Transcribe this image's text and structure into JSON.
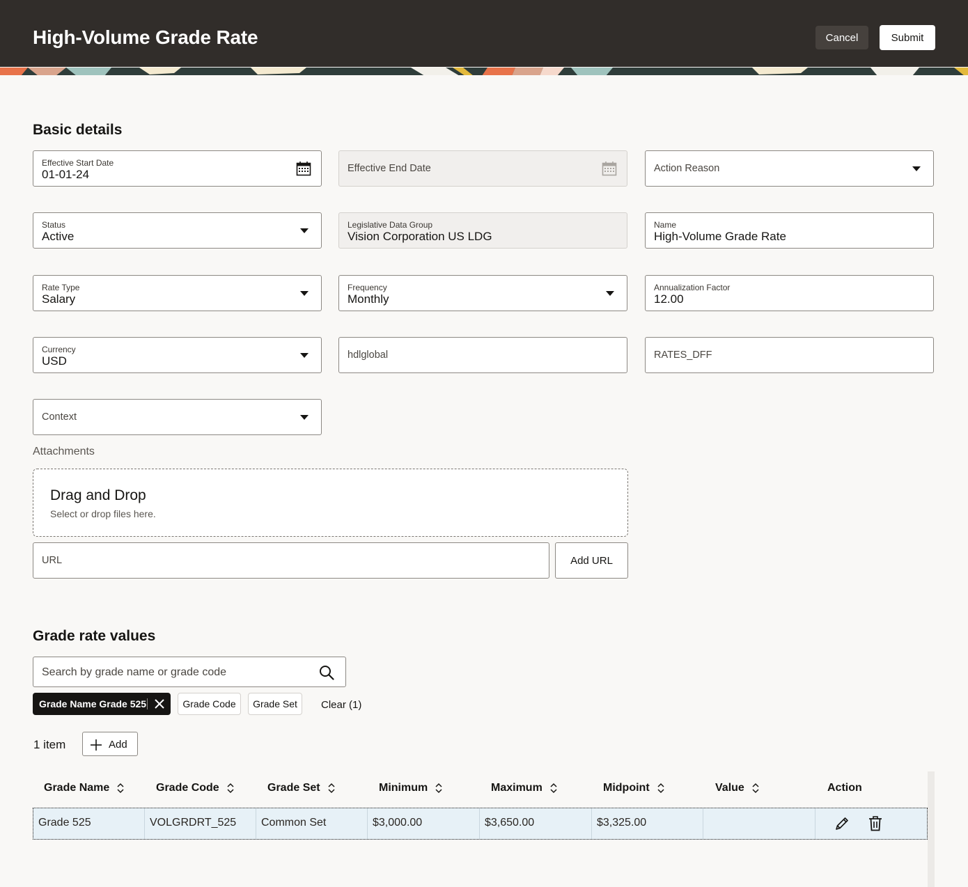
{
  "header": {
    "title": "High-Volume Grade Rate",
    "cancel_label": "Cancel",
    "submit_label": "Submit",
    "bg_color": "#312d2a"
  },
  "basic_details": {
    "title": "Basic details",
    "effective_start_date": {
      "label": "Effective Start Date",
      "value": "01-01-24"
    },
    "effective_end_date": {
      "placeholder": "Effective End Date"
    },
    "action_reason": {
      "placeholder": "Action Reason"
    },
    "status": {
      "label": "Status",
      "value": "Active"
    },
    "legislative_data_group": {
      "label": "Legislative Data Group",
      "value": "Vision Corporation US LDG"
    },
    "name": {
      "label": "Name",
      "value": "High-Volume Grade Rate"
    },
    "rate_type": {
      "label": "Rate Type",
      "value": "Salary"
    },
    "frequency": {
      "label": "Frequency",
      "value": "Monthly"
    },
    "annualization_factor": {
      "label": "Annualization Factor",
      "value": "12.00"
    },
    "currency": {
      "label": "Currency",
      "value": "USD"
    },
    "hdlglobal": {
      "placeholder": "hdlglobal"
    },
    "rates_dff": {
      "placeholder": "RATES_DFF"
    },
    "context": {
      "placeholder": "Context"
    }
  },
  "attachments": {
    "label": "Attachments",
    "drop_title": "Drag and Drop",
    "drop_subtitle": "Select or drop files here.",
    "url_placeholder": "URL",
    "add_url_label": "Add URL"
  },
  "grade_rate_values": {
    "title": "Grade rate values",
    "search_placeholder": "Search by grade name or grade code",
    "filters": {
      "active_chip": "Grade Name Grade 525",
      "grade_code": "Grade Code",
      "grade_set": "Grade Set",
      "clear": "Clear (1)"
    },
    "item_count": "1 item",
    "add_label": "Add",
    "columns": [
      "Grade Name",
      "Grade Code",
      "Grade Set",
      "Minimum",
      "Maximum",
      "Midpoint",
      "Value",
      "Action"
    ],
    "rows": [
      {
        "grade_name": "Grade 525",
        "grade_code": "VOLGRDRT_525",
        "grade_set": "Common Set",
        "minimum": "$3,000.00",
        "maximum": "$3,650.00",
        "midpoint": "$3,325.00",
        "value": ""
      }
    ],
    "row_highlight_color": "#e7f1f7"
  }
}
